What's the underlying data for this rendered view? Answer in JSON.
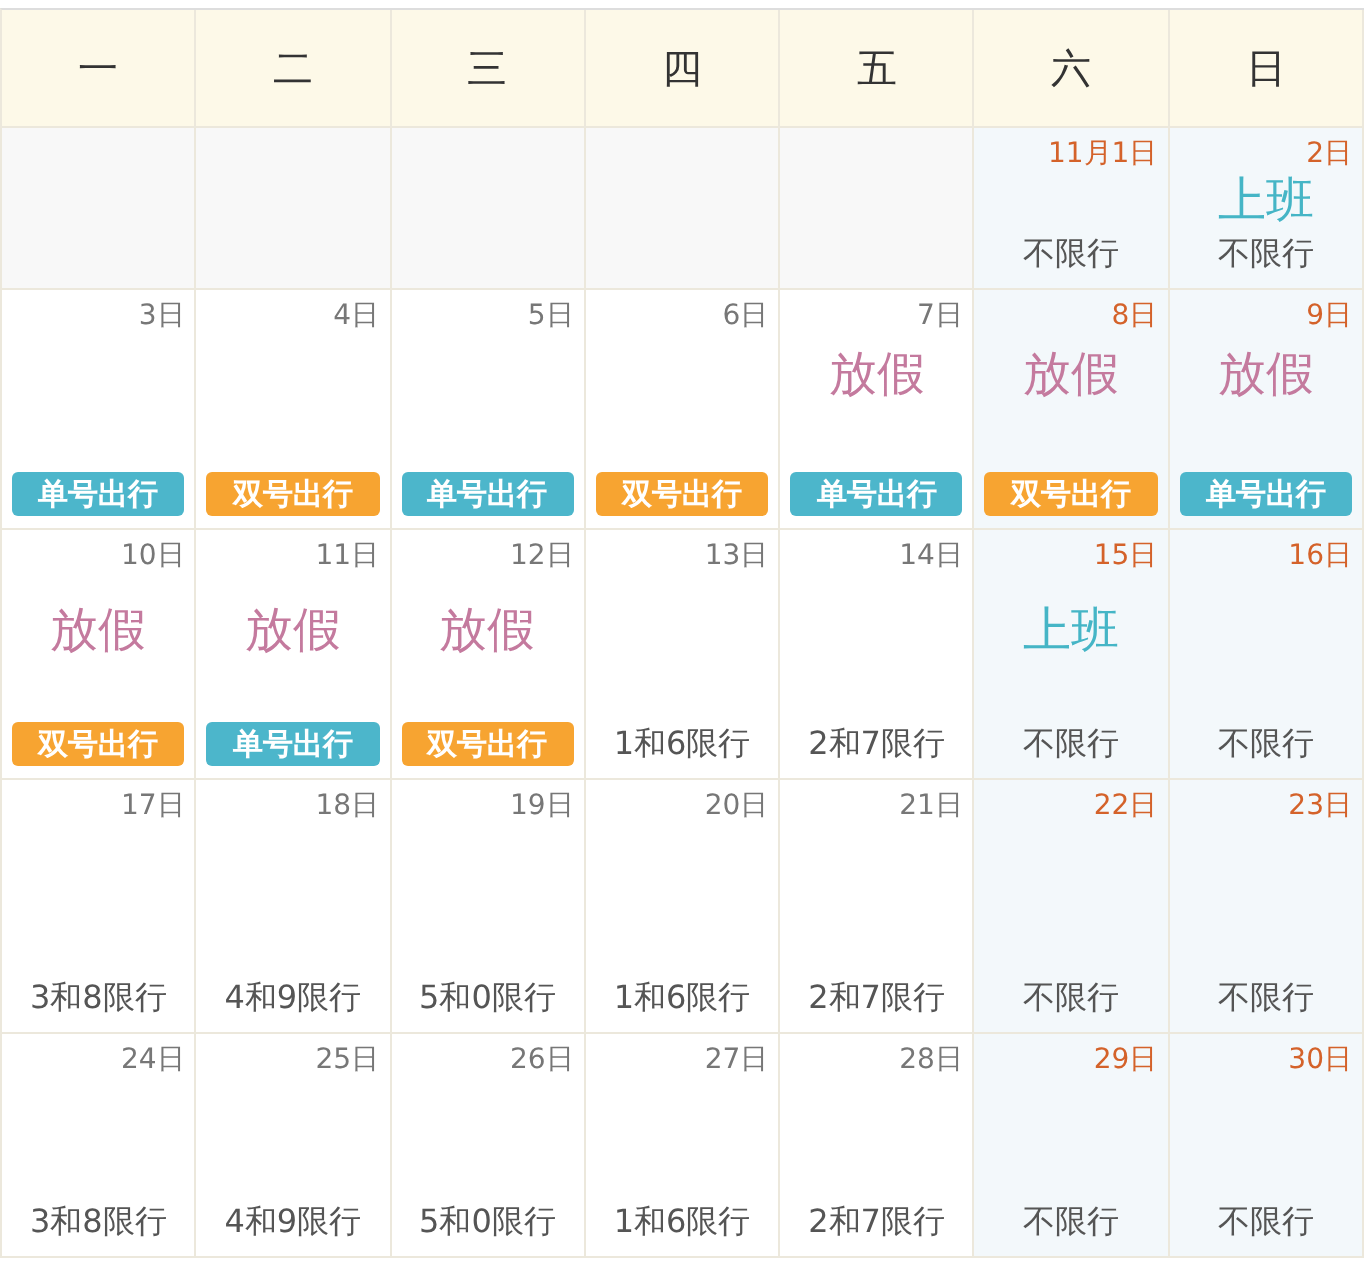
{
  "weekdays": [
    "一",
    "二",
    "三",
    "四",
    "五",
    "六",
    "日"
  ],
  "weeks": [
    [
      {
        "kind": "blank"
      },
      {
        "kind": "blank"
      },
      {
        "kind": "blank"
      },
      {
        "kind": "blank"
      },
      {
        "kind": "blank"
      },
      {
        "kind": "day",
        "date": "11月1日",
        "weekend": true,
        "rule": {
          "kind": "plain",
          "text": "不限行"
        }
      },
      {
        "kind": "day",
        "date": "2日",
        "weekend": true,
        "note": {
          "kind": "work",
          "text": "上班"
        },
        "rule": {
          "kind": "plain",
          "text": "不限行"
        }
      }
    ],
    [
      {
        "kind": "day",
        "date": "3日",
        "weekend": false,
        "rule": {
          "kind": "odd",
          "text": "单号出行"
        }
      },
      {
        "kind": "day",
        "date": "4日",
        "weekend": false,
        "rule": {
          "kind": "even",
          "text": "双号出行"
        }
      },
      {
        "kind": "day",
        "date": "5日",
        "weekend": false,
        "rule": {
          "kind": "odd",
          "text": "单号出行"
        }
      },
      {
        "kind": "day",
        "date": "6日",
        "weekend": false,
        "rule": {
          "kind": "even",
          "text": "双号出行"
        }
      },
      {
        "kind": "day",
        "date": "7日",
        "weekend": false,
        "note": {
          "kind": "holiday",
          "text": "放假"
        },
        "rule": {
          "kind": "odd",
          "text": "单号出行"
        }
      },
      {
        "kind": "day",
        "date": "8日",
        "weekend": true,
        "note": {
          "kind": "holiday",
          "text": "放假"
        },
        "rule": {
          "kind": "even",
          "text": "双号出行"
        }
      },
      {
        "kind": "day",
        "date": "9日",
        "weekend": true,
        "note": {
          "kind": "holiday",
          "text": "放假"
        },
        "rule": {
          "kind": "odd",
          "text": "单号出行"
        }
      }
    ],
    [
      {
        "kind": "day",
        "date": "10日",
        "weekend": false,
        "note": {
          "kind": "holiday",
          "text": "放假"
        },
        "rule": {
          "kind": "even",
          "text": "双号出行"
        }
      },
      {
        "kind": "day",
        "date": "11日",
        "weekend": false,
        "note": {
          "kind": "holiday",
          "text": "放假"
        },
        "rule": {
          "kind": "odd",
          "text": "单号出行"
        }
      },
      {
        "kind": "day",
        "date": "12日",
        "weekend": false,
        "note": {
          "kind": "holiday",
          "text": "放假"
        },
        "rule": {
          "kind": "even",
          "text": "双号出行"
        }
      },
      {
        "kind": "day",
        "date": "13日",
        "weekend": false,
        "rule": {
          "kind": "plain",
          "text": "1和6限行"
        }
      },
      {
        "kind": "day",
        "date": "14日",
        "weekend": false,
        "rule": {
          "kind": "plain",
          "text": "2和7限行"
        }
      },
      {
        "kind": "day",
        "date": "15日",
        "weekend": true,
        "note": {
          "kind": "work",
          "text": "上班"
        },
        "rule": {
          "kind": "plain",
          "text": "不限行"
        }
      },
      {
        "kind": "day",
        "date": "16日",
        "weekend": true,
        "rule": {
          "kind": "plain",
          "text": "不限行"
        }
      }
    ],
    [
      {
        "kind": "day",
        "date": "17日",
        "weekend": false,
        "rule": {
          "kind": "plain",
          "text": "3和8限行"
        }
      },
      {
        "kind": "day",
        "date": "18日",
        "weekend": false,
        "rule": {
          "kind": "plain",
          "text": "4和9限行"
        }
      },
      {
        "kind": "day",
        "date": "19日",
        "weekend": false,
        "rule": {
          "kind": "plain",
          "text": "5和0限行"
        }
      },
      {
        "kind": "day",
        "date": "20日",
        "weekend": false,
        "rule": {
          "kind": "plain",
          "text": "1和6限行"
        }
      },
      {
        "kind": "day",
        "date": "21日",
        "weekend": false,
        "rule": {
          "kind": "plain",
          "text": "2和7限行"
        }
      },
      {
        "kind": "day",
        "date": "22日",
        "weekend": true,
        "rule": {
          "kind": "plain",
          "text": "不限行"
        }
      },
      {
        "kind": "day",
        "date": "23日",
        "weekend": true,
        "rule": {
          "kind": "plain",
          "text": "不限行"
        }
      }
    ],
    [
      {
        "kind": "day",
        "date": "24日",
        "weekend": false,
        "rule": {
          "kind": "plain",
          "text": "3和8限行"
        }
      },
      {
        "kind": "day",
        "date": "25日",
        "weekend": false,
        "rule": {
          "kind": "plain",
          "text": "4和9限行"
        }
      },
      {
        "kind": "day",
        "date": "26日",
        "weekend": false,
        "rule": {
          "kind": "plain",
          "text": "5和0限行"
        }
      },
      {
        "kind": "day",
        "date": "27日",
        "weekend": false,
        "rule": {
          "kind": "plain",
          "text": "1和6限行"
        }
      },
      {
        "kind": "day",
        "date": "28日",
        "weekend": false,
        "rule": {
          "kind": "plain",
          "text": "2和7限行"
        }
      },
      {
        "kind": "day",
        "date": "29日",
        "weekend": true,
        "rule": {
          "kind": "plain",
          "text": "不限行"
        }
      },
      {
        "kind": "day",
        "date": "30日",
        "weekend": true,
        "rule": {
          "kind": "plain",
          "text": "不限行"
        }
      }
    ]
  ]
}
